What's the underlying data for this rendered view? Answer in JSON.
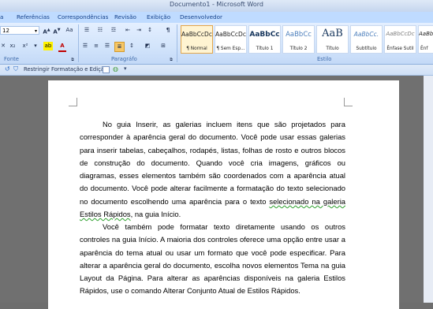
{
  "window": {
    "title": "Documento1 - Microsoft Word"
  },
  "tabs": [
    "a",
    "Referências",
    "Correspondências",
    "Revisão",
    "Exibição",
    "Desenvolvedor"
  ],
  "font_group": {
    "font_size": "12",
    "label": "Fonte",
    "grow": "A",
    "shrink": "A",
    "clear": "Aa",
    "subscript": "x₂",
    "superscript": "x²",
    "font_color": "A"
  },
  "paragraph_group": {
    "label": "Paragráfo",
    "show_marks": "¶"
  },
  "styles_group": {
    "label": "Estilo",
    "items": [
      {
        "sample": "AaBbCcDc",
        "name": "¶ Normal"
      },
      {
        "sample": "AaBbCcDc",
        "name": "¶ Sem Esp..."
      },
      {
        "sample": "AaBbCc",
        "name": "Título 1"
      },
      {
        "sample": "AaBbCc",
        "name": "Título 2"
      },
      {
        "sample": "AaB",
        "name": "Título"
      },
      {
        "sample": "AaBbCc.",
        "name": "Subtítulo"
      },
      {
        "sample": "AaBbCcDc",
        "name": "Ênfase Sutil"
      },
      {
        "sample": "AaBbC",
        "name": "Ênf"
      }
    ]
  },
  "qat": {
    "restrict_label": "Restringir Formatação e Edição"
  },
  "document": {
    "p1_before": "No guia Inserir, as galerias incluem itens que são projetados para corresponder à aparência geral do documento. Você pode usar essas galerias para inserir tabelas, cabeçalhos, rodapés, listas, folhas de rosto e outros blocos de construção do documento. Quando você cria imagens, gráficos ou diagramas, esses elementos também são coordenados com a aparência atual do documento. Você pode alterar facilmente a formatação do texto selecionado no documento escolhendo uma aparência para o texto ",
    "p1_underlined_a": "selecionado na galeria",
    "p1_underlined_b": "Estilos Rápidos",
    "p1_after": ", na guia Início.",
    "p2": "Você também pode formatar texto diretamente usando os outros controles na guia Início. A maioria dos controles oferece uma opção entre usar a aparência do tema atual ou usar um formato que você pode especificar. Para alterar a aparência geral do documento, escolha novos elementos Tema na guia Layout da Página. Para alterar as aparências disponíveis na galeria Estilos Rápidos, use o comando Alterar Conjunto Atual de Estilos Rápidos."
  }
}
